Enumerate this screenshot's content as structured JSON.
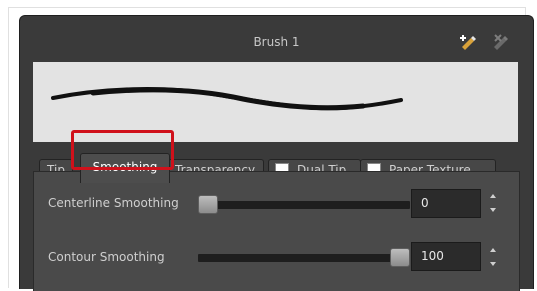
{
  "window": {
    "title": "Brush 1"
  },
  "toolbar": {
    "new_icon": "new-brush-icon",
    "delete_icon": "delete-brush-icon"
  },
  "tabs": [
    {
      "label": "Tip",
      "selected": false
    },
    {
      "label": "Smoothing",
      "selected": true
    },
    {
      "label": "Transparency",
      "selected": false
    },
    {
      "label": "Dual Tip",
      "checkbox": false,
      "selected": false
    },
    {
      "label": "Paper Texture",
      "checkbox": false,
      "selected": false
    }
  ],
  "smoothing": {
    "centerline": {
      "label": "Centerline Smoothing",
      "value": "0",
      "level": 0
    },
    "contour": {
      "label": "Contour Smoothing",
      "value": "100",
      "level": 1
    }
  },
  "colors": {
    "panel": "#3a3a3a",
    "highlight": "#d0111b",
    "preview": "#e3e3e3"
  }
}
